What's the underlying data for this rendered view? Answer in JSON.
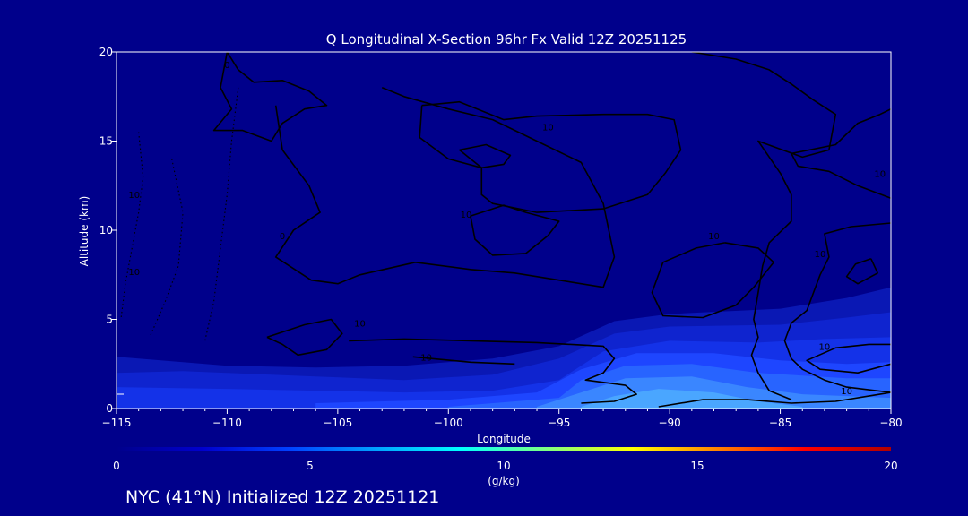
{
  "chart_data": {
    "type": "heatmap",
    "title": "Q Longitudinal X-Section 96hr  Fx Valid 12Z 20251125",
    "xlabel": "Longitude",
    "ylabel": "Altitude (km)",
    "xlim": [
      -115,
      -80
    ],
    "ylim": [
      0,
      20
    ],
    "x_ticks": [
      -115,
      -110,
      -105,
      -100,
      -95,
      -90,
      -85,
      -80
    ],
    "x_tick_labels": [
      "−115",
      "−110",
      "−105",
      "−100",
      "−95",
      "−90",
      "−85",
      "−80"
    ],
    "y_ticks": [
      0,
      5,
      10,
      15,
      20
    ],
    "grid": false,
    "field_unit": "(g/kg)",
    "colorbar": {
      "min": 0,
      "max": 20,
      "ticks": [
        0,
        5,
        10,
        15,
        20
      ],
      "colors": [
        "#00008b",
        "#0000cd",
        "#0040ff",
        "#00a0ff",
        "#00ffff",
        "#80ff80",
        "#ffff00",
        "#ff8000",
        "#ff0000",
        "#b00000"
      ]
    },
    "filled_layers": [
      {
        "q": 1,
        "color": "#0a18b4",
        "top": [
          [
            -115,
            2.9
          ],
          [
            -112,
            2.6
          ],
          [
            -110,
            2.4
          ],
          [
            -106,
            2.3
          ],
          [
            -102,
            2.4
          ],
          [
            -98,
            2.8
          ],
          [
            -95,
            3.5
          ],
          [
            -92.5,
            4.9
          ],
          [
            -90,
            5.3
          ],
          [
            -85,
            5.6
          ],
          [
            -82,
            6.2
          ],
          [
            -80,
            6.8
          ]
        ]
      },
      {
        "q": 2,
        "color": "#0f24cf",
        "top": [
          [
            -115,
            2.0
          ],
          [
            -112,
            2.1
          ],
          [
            -110,
            2.0
          ],
          [
            -106,
            1.8
          ],
          [
            -102,
            1.6
          ],
          [
            -98,
            1.9
          ],
          [
            -95,
            2.8
          ],
          [
            -92.5,
            4.2
          ],
          [
            -90,
            4.6
          ],
          [
            -85,
            4.7
          ],
          [
            -82,
            5.1
          ],
          [
            -80,
            5.4
          ]
        ]
      },
      {
        "q": 3,
        "color": "#1432e8",
        "top": [
          [
            -115,
            1.2
          ],
          [
            -110,
            1.1
          ],
          [
            -106,
            1.0
          ],
          [
            -102,
            0.9
          ],
          [
            -98,
            1.0
          ],
          [
            -95,
            1.6
          ],
          [
            -93,
            3.2
          ],
          [
            -90,
            3.8
          ],
          [
            -86,
            3.7
          ],
          [
            -83,
            3.9
          ],
          [
            -80,
            4.0
          ]
        ]
      },
      {
        "q": 4,
        "color": "#1e46ff",
        "top": [
          [
            -106,
            0.3
          ],
          [
            -100,
            0.5
          ],
          [
            -96,
            0.9
          ],
          [
            -94,
            2.2
          ],
          [
            -91.5,
            3.1
          ],
          [
            -88,
            3.1
          ],
          [
            -85,
            2.7
          ],
          [
            -82,
            2.5
          ],
          [
            -80,
            2.6
          ]
        ]
      },
      {
        "q": 5,
        "color": "#2864ff",
        "top": [
          [
            -100,
            0.1
          ],
          [
            -95,
            0.6
          ],
          [
            -94,
            1.6
          ],
          [
            -92,
            2.4
          ],
          [
            -89,
            2.5
          ],
          [
            -86,
            2.0
          ],
          [
            -82,
            1.7
          ],
          [
            -80,
            1.7
          ]
        ]
      },
      {
        "q": 6,
        "color": "#3a86ff",
        "top": [
          [
            -96,
            0.1
          ],
          [
            -94,
            0.9
          ],
          [
            -92,
            1.7
          ],
          [
            -89,
            1.8
          ],
          [
            -86.5,
            1.2
          ],
          [
            -84,
            0.8
          ],
          [
            -80,
            0.6
          ]
        ]
      },
      {
        "q": 7,
        "color": "#4aa6ff",
        "top": [
          [
            -94,
            0.1
          ],
          [
            -92.5,
            0.7
          ],
          [
            -90.5,
            1.1
          ],
          [
            -88,
            0.9
          ],
          [
            -86,
            0.4
          ],
          [
            -84,
            0.1
          ]
        ]
      }
    ],
    "contours": [
      {
        "label": "10",
        "label_at": [
          -114.2,
          11.8
        ],
        "dashed": true,
        "points": [
          [
            -114,
            15.5
          ],
          [
            -113.8,
            13.0
          ],
          [
            -114.0,
            11.0
          ],
          [
            -114.3,
            9.0
          ],
          [
            -114.6,
            7.0
          ],
          [
            -114.8,
            5.0
          ]
        ]
      },
      {
        "label": "10",
        "label_at": [
          -114.2,
          7.5
        ],
        "dashed": true,
        "points": [
          [
            -112.5,
            14.0
          ],
          [
            -112.0,
            11.0
          ],
          [
            -112.2,
            8.0
          ],
          [
            -112.8,
            6.0
          ],
          [
            -113.5,
            4.0
          ]
        ]
      },
      {
        "label": "",
        "label_at": null,
        "dashed": true,
        "points": [
          [
            -109.5,
            18.0
          ],
          [
            -109.8,
            15.0
          ],
          [
            -110.0,
            12.0
          ],
          [
            -110.3,
            9.0
          ],
          [
            -110.6,
            6.0
          ],
          [
            -111.0,
            3.8
          ]
        ]
      },
      {
        "label": "0",
        "label_at": [
          -110.0,
          19.1
        ],
        "dashed": false,
        "points": [
          [
            -110.0,
            20.0
          ],
          [
            -109.5,
            19.0
          ],
          [
            -108.8,
            18.3
          ],
          [
            -107.5,
            18.4
          ],
          [
            -106.3,
            17.8
          ],
          [
            -105.5,
            17.0
          ],
          [
            -106.5,
            16.8
          ],
          [
            -107.5,
            16.0
          ],
          [
            -108.0,
            15.0
          ],
          [
            -109.3,
            15.6
          ],
          [
            -110.6,
            15.6
          ],
          [
            -109.8,
            16.8
          ],
          [
            -110.3,
            18.0
          ],
          [
            -110.0,
            20.0
          ]
        ]
      },
      {
        "label": "0",
        "label_at": [
          -107.5,
          9.5
        ],
        "dashed": false,
        "points": [
          [
            -107.8,
            17.0
          ],
          [
            -107.5,
            14.5
          ],
          [
            -106.3,
            12.5
          ],
          [
            -105.8,
            11.0
          ],
          [
            -107.0,
            10.0
          ],
          [
            -107.8,
            8.5
          ],
          [
            -106.2,
            7.2
          ],
          [
            -105.0,
            7.0
          ],
          [
            -104.0,
            7.5
          ],
          [
            -101.5,
            8.2
          ],
          [
            -99.0,
            7.8
          ],
          [
            -97.0,
            7.6
          ],
          [
            -95.0,
            7.2
          ],
          [
            -93.0,
            6.8
          ],
          [
            -92.5,
            8.5
          ],
          [
            -93.0,
            11.5
          ],
          [
            -94.0,
            13.8
          ],
          [
            -96.0,
            15.0
          ],
          [
            -98.0,
            16.2
          ],
          [
            -100.0,
            16.8
          ],
          [
            -102.0,
            17.5
          ],
          [
            -103.0,
            18.0
          ]
        ]
      },
      {
        "label": "10",
        "label_at": [
          -95.5,
          15.6
        ],
        "dashed": false,
        "points": [
          [
            -101.2,
            17.0
          ],
          [
            -101.3,
            15.2
          ],
          [
            -100.0,
            14.0
          ],
          [
            -98.5,
            13.5
          ],
          [
            -98.5,
            12.0
          ],
          [
            -98.0,
            11.5
          ],
          [
            -96.0,
            11.0
          ],
          [
            -93.0,
            11.2
          ],
          [
            -91.0,
            12.0
          ],
          [
            -90.2,
            13.2
          ],
          [
            -89.5,
            14.5
          ],
          [
            -89.8,
            16.2
          ],
          [
            -91.0,
            16.5
          ],
          [
            -93.0,
            16.5
          ],
          [
            -96.0,
            16.4
          ],
          [
            -97.5,
            16.2
          ],
          [
            -99.5,
            17.2
          ],
          [
            -101.2,
            17.0
          ]
        ]
      },
      {
        "label": "",
        "label_at": null,
        "dashed": false,
        "points": [
          [
            -99.5,
            14.5
          ],
          [
            -98.5,
            13.5
          ],
          [
            -97.5,
            13.7
          ],
          [
            -97.2,
            14.2
          ],
          [
            -98.3,
            14.8
          ],
          [
            -99.5,
            14.5
          ]
        ]
      },
      {
        "label": "10",
        "label_at": [
          -99.2,
          10.7
        ],
        "dashed": false,
        "points": [
          [
            -99.0,
            10.8
          ],
          [
            -97.5,
            11.4
          ],
          [
            -96.5,
            11.0
          ],
          [
            -95.0,
            10.5
          ],
          [
            -95.5,
            9.7
          ],
          [
            -96.5,
            8.7
          ],
          [
            -98.0,
            8.6
          ],
          [
            -98.8,
            9.5
          ],
          [
            -99.0,
            10.8
          ]
        ]
      },
      {
        "label": "10",
        "label_at": [
          -88.0,
          9.5
        ],
        "dashed": false,
        "points": [
          [
            -89.0,
            20.0
          ],
          [
            -87.0,
            19.6
          ],
          [
            -85.5,
            19.0
          ],
          [
            -84.5,
            18.2
          ],
          [
            -83.5,
            17.3
          ],
          [
            -82.5,
            16.5
          ],
          [
            -82.8,
            14.5
          ],
          [
            -84.0,
            14.1
          ],
          [
            -86.0,
            15.0
          ],
          [
            -85.0,
            13.2
          ],
          [
            -84.5,
            12.0
          ],
          [
            -84.5,
            10.5
          ],
          [
            -85.5,
            9.3
          ],
          [
            -85.8,
            8.0
          ],
          [
            -86.0,
            6.5
          ],
          [
            -86.2,
            5.0
          ],
          [
            -86.0,
            4.0
          ],
          [
            -86.3,
            3.0
          ],
          [
            -86.0,
            2.0
          ],
          [
            -85.5,
            1.0
          ],
          [
            -84.5,
            0.5
          ]
        ]
      },
      {
        "label": "",
        "label_at": null,
        "dashed": false,
        "points": [
          [
            -87.5,
            9.3
          ],
          [
            -86.0,
            9.0
          ],
          [
            -85.3,
            8.2
          ],
          [
            -86.2,
            6.8
          ],
          [
            -87.0,
            5.8
          ],
          [
            -88.5,
            5.1
          ],
          [
            -90.3,
            5.2
          ],
          [
            -90.8,
            6.5
          ],
          [
            -90.3,
            8.2
          ],
          [
            -88.8,
            9.0
          ],
          [
            -87.5,
            9.3
          ]
        ]
      },
      {
        "label": "10",
        "label_at": [
          -80.5,
          13.0
        ],
        "dashed": false,
        "points": [
          [
            -80.0,
            11.8
          ],
          [
            -81.5,
            12.5
          ],
          [
            -82.8,
            13.3
          ],
          [
            -84.2,
            13.6
          ],
          [
            -84.5,
            14.3
          ],
          [
            -82.5,
            14.8
          ],
          [
            -81.5,
            16.0
          ],
          [
            -80.5,
            16.5
          ],
          [
            -80.0,
            16.8
          ]
        ]
      },
      {
        "label": "10",
        "label_at": [
          -83.2,
          8.5
        ],
        "dashed": false,
        "points": [
          [
            -80.0,
            10.4
          ],
          [
            -81.8,
            10.2
          ],
          [
            -83.0,
            9.8
          ],
          [
            -82.8,
            8.5
          ],
          [
            -83.2,
            7.5
          ],
          [
            -83.5,
            6.5
          ],
          [
            -83.8,
            5.5
          ],
          [
            -84.5,
            4.8
          ],
          [
            -84.8,
            3.8
          ],
          [
            -84.5,
            2.8
          ],
          [
            -84.0,
            2.2
          ],
          [
            -83.0,
            1.6
          ],
          [
            -82.0,
            1.2
          ],
          [
            -80.0,
            0.9
          ]
        ]
      },
      {
        "label": "",
        "label_at": null,
        "dashed": false,
        "points": [
          [
            -80.9,
            8.4
          ],
          [
            -80.6,
            7.6
          ],
          [
            -81.5,
            7.0
          ],
          [
            -82.0,
            7.4
          ],
          [
            -81.6,
            8.1
          ],
          [
            -80.9,
            8.4
          ]
        ]
      },
      {
        "label": "10",
        "label_at": [
          -83.0,
          3.3
        ],
        "dashed": false,
        "points": [
          [
            -80.0,
            3.6
          ],
          [
            -81.0,
            3.6
          ],
          [
            -82.5,
            3.4
          ],
          [
            -83.8,
            2.7
          ],
          [
            -83.2,
            2.2
          ],
          [
            -81.5,
            2.0
          ],
          [
            -80.0,
            2.5
          ]
        ]
      },
      {
        "label": "10",
        "label_at": [
          -82.0,
          0.8
        ],
        "dashed": false,
        "points": [
          [
            -90.5,
            0.1
          ],
          [
            -88.5,
            0.5
          ],
          [
            -86.5,
            0.5
          ],
          [
            -84.5,
            0.3
          ],
          [
            -82.5,
            0.4
          ],
          [
            -81.0,
            0.7
          ],
          [
            -80.0,
            0.9
          ]
        ]
      },
      {
        "label": "10",
        "label_at": [
          -104.0,
          4.6
        ],
        "dashed": false,
        "points": [
          [
            -108.2,
            4.0
          ],
          [
            -106.5,
            4.7
          ],
          [
            -105.3,
            5.0
          ],
          [
            -104.8,
            4.2
          ],
          [
            -105.5,
            3.3
          ],
          [
            -106.8,
            3.0
          ],
          [
            -107.5,
            3.6
          ],
          [
            -108.2,
            4.0
          ]
        ]
      },
      {
        "label": "10",
        "label_at": [
          -101.0,
          2.7
        ],
        "dashed": false,
        "points": [
          [
            -101.6,
            2.9
          ],
          [
            -99.0,
            2.6
          ],
          [
            -97.0,
            2.5
          ]
        ]
      },
      {
        "label": "",
        "label_at": null,
        "dashed": false,
        "points": [
          [
            -104.5,
            3.8
          ],
          [
            -102.0,
            3.9
          ],
          [
            -99.0,
            3.8
          ],
          [
            -96.0,
            3.7
          ],
          [
            -93.0,
            3.5
          ],
          [
            -92.5,
            2.8
          ],
          [
            -93.0,
            2.0
          ],
          [
            -93.8,
            1.6
          ],
          [
            -92.0,
            1.3
          ],
          [
            -91.5,
            0.8
          ],
          [
            -92.5,
            0.4
          ],
          [
            -94.0,
            0.3
          ]
        ]
      }
    ]
  },
  "footer": {
    "station_text": "NYC (41°N) Initialized 12Z 20251121"
  }
}
